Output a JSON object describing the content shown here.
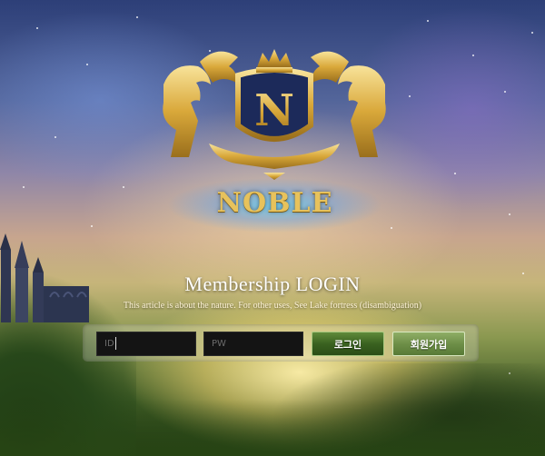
{
  "brand": {
    "name": "NOBLE",
    "emblem_letter": "N",
    "gold": "#e7c25c"
  },
  "login": {
    "title": "Membership LOGIN",
    "subtitle": "This article is about the nature. For other uses, See Lake fortress (disambiguation)",
    "id_placeholder": "ID",
    "pw_placeholder": "PW",
    "login_label": "로그인",
    "join_label": "회원가입"
  },
  "colors": {
    "login_button": "#3a6220",
    "join_button": "#6e8f48"
  }
}
